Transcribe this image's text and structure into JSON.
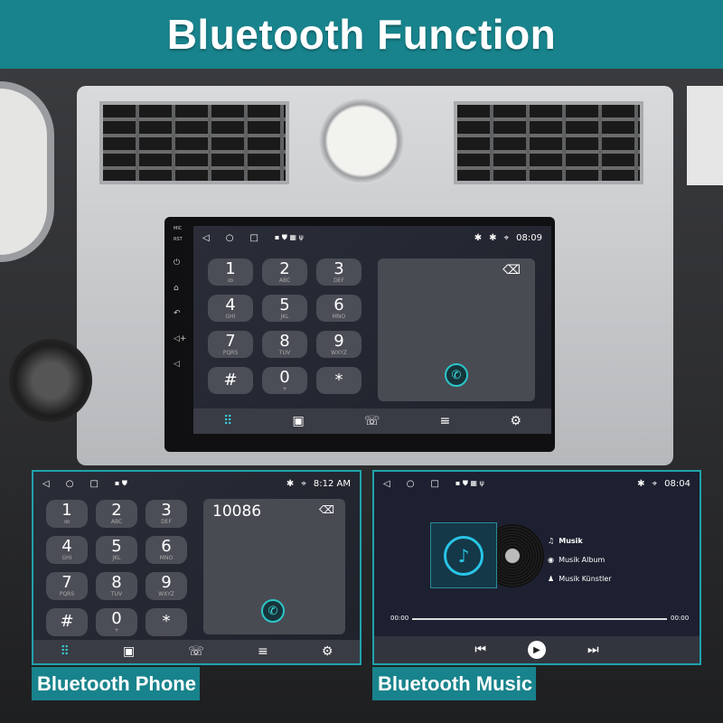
{
  "title": "Bluetooth Function",
  "colors": {
    "banner": "#18838c",
    "accent": "#2cc6c8"
  },
  "keypad": [
    {
      "digit": "1",
      "sub": "ꝏ"
    },
    {
      "digit": "2",
      "sub": "ABC"
    },
    {
      "digit": "3",
      "sub": "DEF"
    },
    {
      "digit": "4",
      "sub": "GHI"
    },
    {
      "digit": "5",
      "sub": "JKL"
    },
    {
      "digit": "6",
      "sub": "MNO"
    },
    {
      "digit": "7",
      "sub": "PQRS"
    },
    {
      "digit": "8",
      "sub": "TUV"
    },
    {
      "digit": "9",
      "sub": "WXYZ"
    },
    {
      "digit": "#",
      "sub": ""
    },
    {
      "digit": "0",
      "sub": "+"
    },
    {
      "digit": "*",
      "sub": ""
    }
  ],
  "main_screen": {
    "time": "08:09",
    "side_labels": [
      "MIC",
      "RST"
    ],
    "dial_value": ""
  },
  "phone_screen": {
    "time": "8:12 AM",
    "dial_value": "10086"
  },
  "music_screen": {
    "time": "08:04",
    "track": "Musik",
    "album": "Musik Album",
    "artist": "Musik Künstler",
    "elapsed": "00:00",
    "duration": "00:00",
    "progress": 0
  },
  "nav_icons": [
    "dialpad-icon",
    "contacts-icon",
    "call-log-icon",
    "music-list-icon",
    "settings-icon"
  ],
  "labels": {
    "phone": "Bluetooth Phone",
    "music": "Bluetooth Music"
  }
}
